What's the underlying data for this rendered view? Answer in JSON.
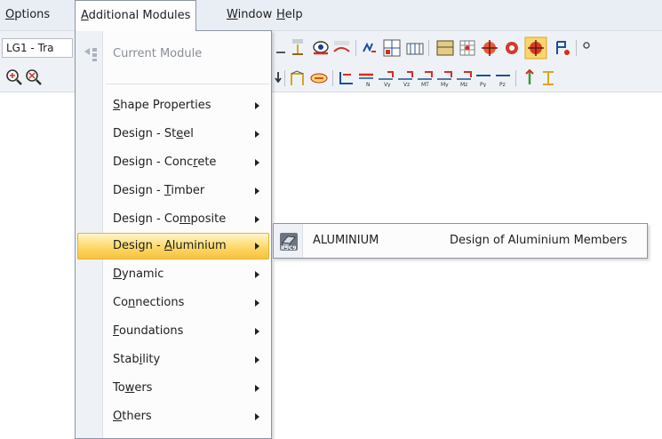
{
  "menubar": {
    "options": {
      "before": "",
      "accel": "O",
      "after": "ptions"
    },
    "additional_modules": {
      "before": "",
      "accel": "A",
      "after": "dditional Modules"
    },
    "window": {
      "before": "",
      "accel": "W",
      "after": "indow"
    },
    "help": {
      "before": "",
      "accel": "H",
      "after": "elp"
    }
  },
  "toolbar": {
    "load_case_value": "LG1 - Tra"
  },
  "dropdown": {
    "items": [
      {
        "before": "Current Module",
        "accel": "",
        "after": "",
        "submenu": false,
        "disabled": true
      },
      {
        "before": "",
        "accel": "S",
        "after": "hape Properties",
        "submenu": true
      },
      {
        "before": "Design - St",
        "accel": "e",
        "after": "el",
        "submenu": true
      },
      {
        "before": "Design - Conc",
        "accel": "r",
        "after": "ete",
        "submenu": true
      },
      {
        "before": "Design - ",
        "accel": "T",
        "after": "imber",
        "submenu": true
      },
      {
        "before": "Design - Co",
        "accel": "m",
        "after": "posite",
        "submenu": true
      },
      {
        "before": "Design - ",
        "accel": "A",
        "after": "luminium",
        "submenu": true,
        "highlighted": true
      },
      {
        "before": "",
        "accel": "D",
        "after": "ynamic",
        "submenu": true
      },
      {
        "before": "Co",
        "accel": "n",
        "after": "nections",
        "submenu": true
      },
      {
        "before": "",
        "accel": "F",
        "after": "oundations",
        "submenu": true
      },
      {
        "before": "Stab",
        "accel": "i",
        "after": "lity",
        "submenu": true
      },
      {
        "before": "To",
        "accel": "w",
        "after": "ers",
        "submenu": true
      },
      {
        "before": "",
        "accel": "O",
        "after": "thers",
        "submenu": true
      }
    ]
  },
  "submenu": {
    "icon_label": "RSC9",
    "name": "ALUMINIUM",
    "description": "Design of Aluminium Members"
  },
  "colors": {
    "highlight": "#fdd86a",
    "menubar_bg": "#e9eef5",
    "menu_border": "#8d95a3"
  }
}
